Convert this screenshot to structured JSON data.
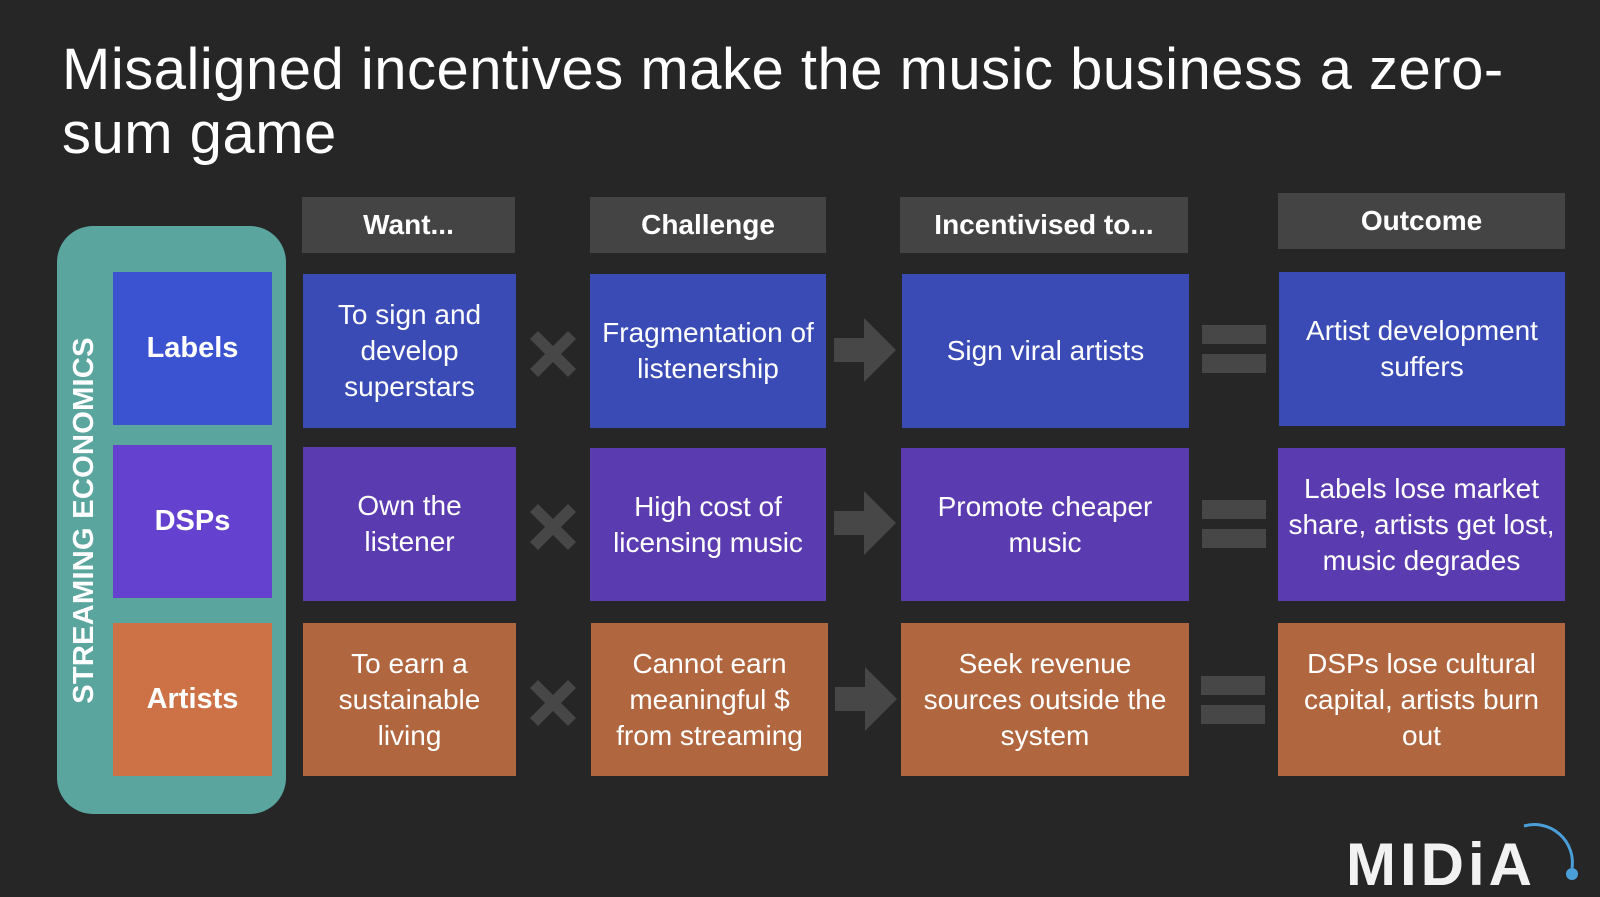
{
  "title": "Misaligned incentives make the music business a zero-sum game",
  "frame_label": "STREAMING ECONOMICS",
  "columns": [
    "Want...",
    "Challenge",
    "Incentivised to...",
    "Outcome"
  ],
  "operators": {
    "multiply": "multiply-icon",
    "leads_to": "arrow-right-icon",
    "equals": "equals-icon"
  },
  "rows": [
    {
      "actor": "Labels",
      "color_actor": "#3b52d1",
      "color_cell": "#3a4bb5",
      "want": "To sign and develop superstars",
      "challenge": "Fragmentation of listenership",
      "incentivised": "Sign viral artists",
      "outcome": "Artist development suffers"
    },
    {
      "actor": "DSPs",
      "color_actor": "#6441cf",
      "color_cell": "#5a3bb0",
      "want": "Own the listener",
      "challenge": "High cost of licensing music",
      "incentivised": "Promote cheaper music",
      "outcome": "Labels lose market share, artists get lost, music degrades"
    },
    {
      "actor": "Artists",
      "color_actor": "#cc7246",
      "color_cell": "#b0663f",
      "want": "To earn a sustainable living",
      "challenge": "Cannot earn meaningful $ from streaming",
      "incentivised": "Seek revenue sources outside the system",
      "outcome": "DSPs lose cultural capital, artists burn out"
    }
  ],
  "colors": {
    "background": "#262626",
    "frame": "#5ba59f",
    "header": "#444444",
    "operator": "#474747",
    "logo_accent": "#4a9fd8"
  },
  "logo": {
    "text": "MIDiA"
  }
}
